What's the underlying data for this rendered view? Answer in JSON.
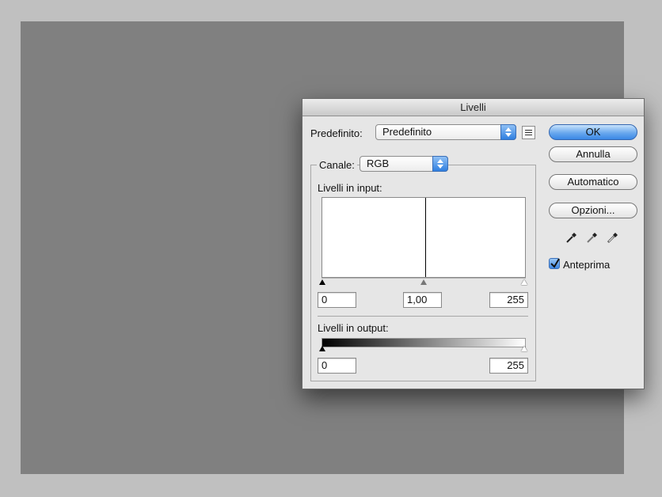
{
  "dialog": {
    "title": "Livelli",
    "preset": {
      "label": "Predefinito:",
      "value": "Predefinito"
    },
    "channel": {
      "label": "Canale:",
      "value": "RGB"
    },
    "input_levels": {
      "label": "Livelli in input:",
      "black": "0",
      "gamma": "1,00",
      "white": "255"
    },
    "output_levels": {
      "label": "Livelli in output:",
      "black": "0",
      "white": "255"
    },
    "buttons": {
      "ok": "OK",
      "cancel": "Annulla",
      "auto": "Automatico",
      "options": "Opzioni..."
    },
    "preview": {
      "label": "Anteprima",
      "checked": true
    },
    "droppers": [
      "black-eyedropper-icon",
      "gray-eyedropper-icon",
      "white-eyedropper-icon"
    ]
  },
  "colors": {
    "canvas": "#808080",
    "workspace": "#c0c0c0",
    "accent": "#3a88e6"
  }
}
